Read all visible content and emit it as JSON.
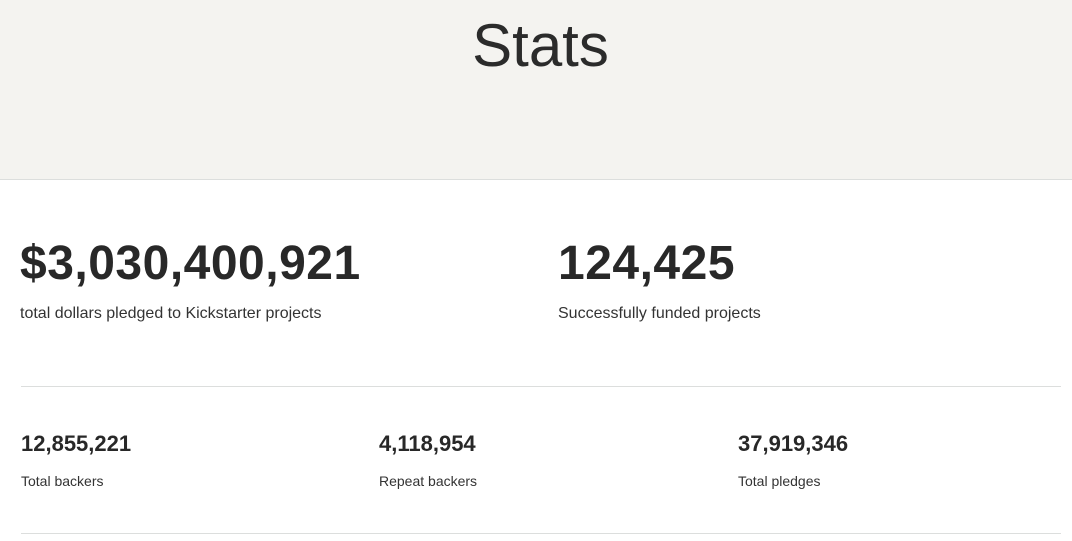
{
  "header": {
    "title": "Stats",
    "background_color": "#f4f3f0"
  },
  "primary_stats": [
    {
      "value": "$3,030,400,921",
      "label": "total dollars pledged to Kickstarter projects"
    },
    {
      "value": "124,425",
      "label": "Successfully funded projects"
    }
  ],
  "secondary_stats": [
    {
      "value": "12,855,221",
      "label": "Total backers"
    },
    {
      "value": "4,118,954",
      "label": "Repeat backers"
    },
    {
      "value": "37,919,346",
      "label": "Total pledges"
    }
  ],
  "colors": {
    "text": "#282828",
    "divider": "#dcdedd"
  }
}
